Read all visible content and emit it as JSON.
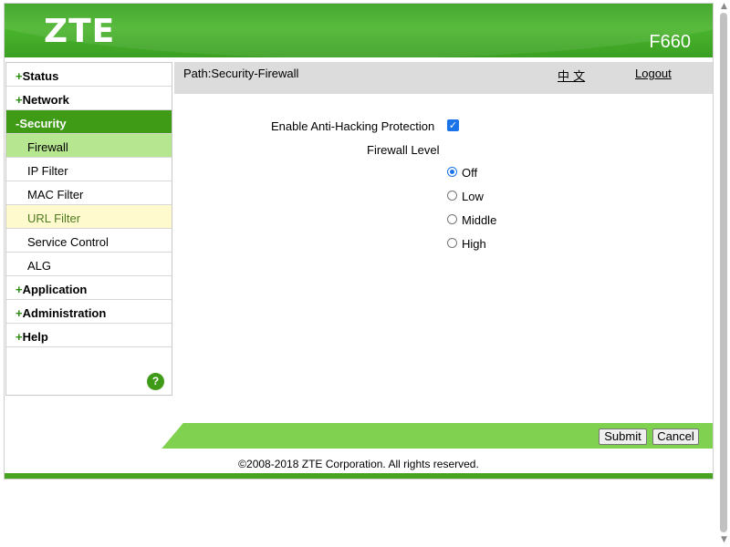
{
  "header": {
    "logo": "ZTE",
    "model": "F660"
  },
  "menu": {
    "items": [
      {
        "sign": "+",
        "label": "Status"
      },
      {
        "sign": "+",
        "label": "Network"
      },
      {
        "sign": "-",
        "label": "Security"
      },
      {
        "sign": "+",
        "label": "Application"
      },
      {
        "sign": "+",
        "label": "Administration"
      },
      {
        "sign": "+",
        "label": "Help"
      }
    ],
    "security_sub": [
      "Firewall",
      "IP Filter",
      "MAC Filter",
      "URL Filter",
      "Service Control",
      "ALG"
    ],
    "selected_sub": "Firewall",
    "help_icon": "?"
  },
  "pathbar": {
    "path": "Path:Security-Firewall",
    "language": "中 文",
    "logout": "Logout"
  },
  "form": {
    "anti_hacking_label": "Enable Anti-Hacking Protection",
    "anti_hacking_checked": true,
    "checkmark": "✓",
    "firewall_level_label": "Firewall Level",
    "levels": [
      "Off",
      "Low",
      "Middle",
      "High"
    ],
    "selected_level": "Off"
  },
  "buttons": {
    "submit": "Submit",
    "cancel": "Cancel"
  },
  "footer": {
    "copyright": "©2008-2018 ZTE Corporation. All rights reserved."
  },
  "colors": {
    "brand_green": "#3f9a16",
    "footer_green": "#7fd14f",
    "accent_blue": "#1a73e8"
  }
}
